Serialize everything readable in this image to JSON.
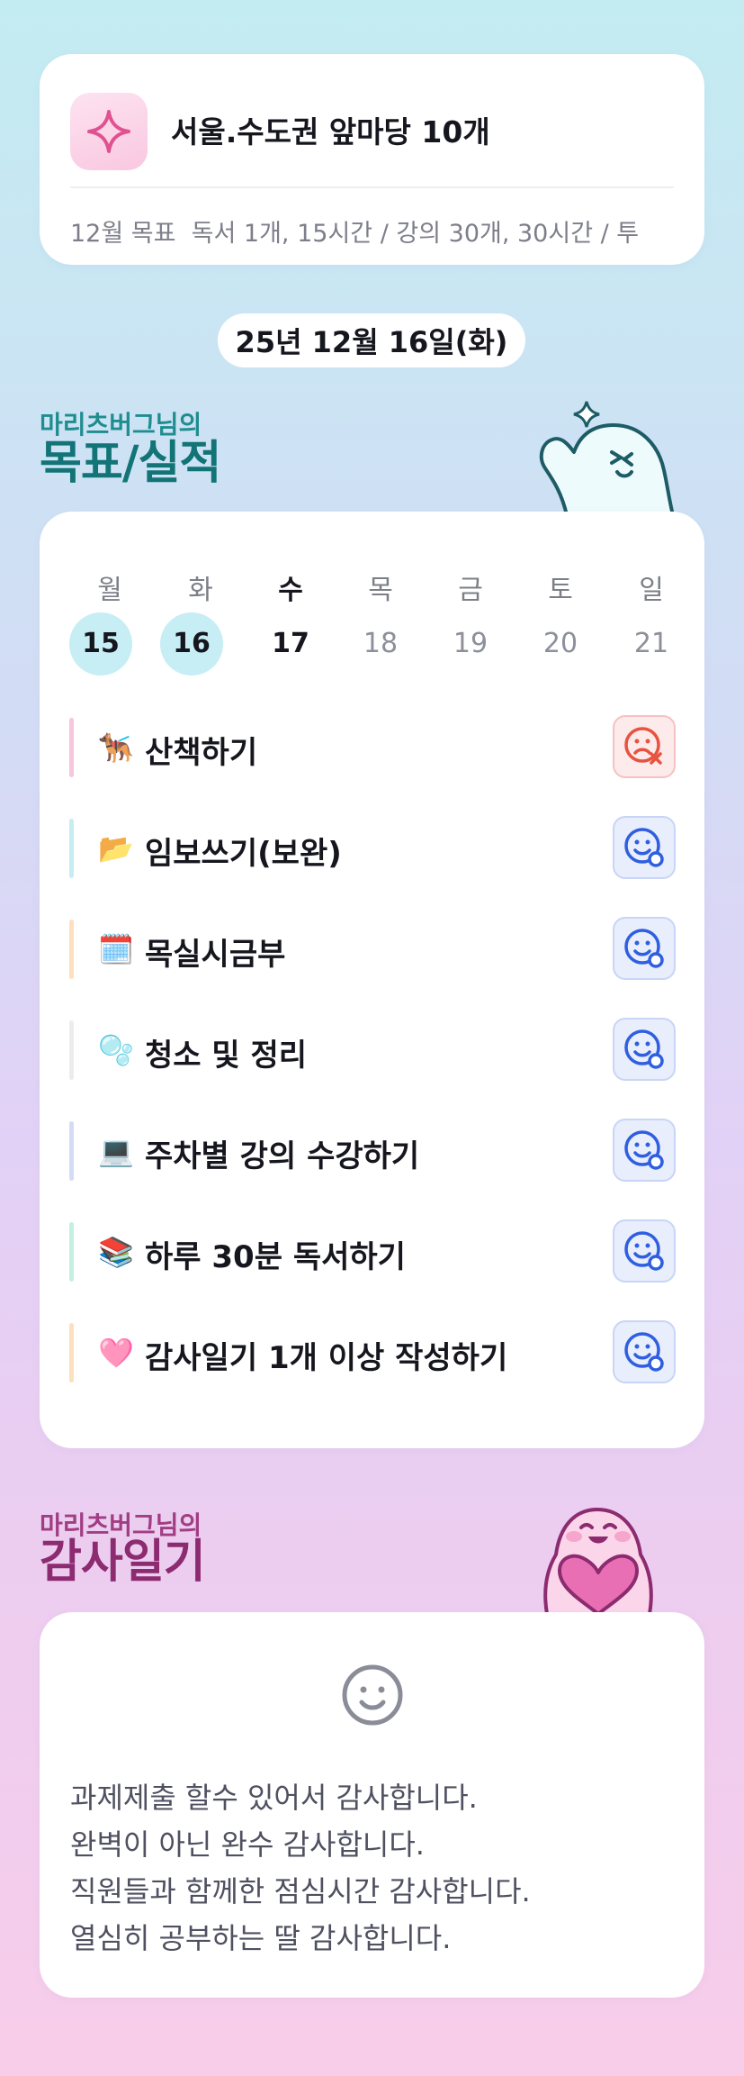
{
  "goal": {
    "icon": "sparkle-icon",
    "title": "서울.수도권 앞마당 10개",
    "monthly_label": "12월 목표",
    "monthly_text": "독서 1개, 15시간 / 강의 30개, 30시간 / 투"
  },
  "date": "25년 12월 16일(화)",
  "goals_section": {
    "subtitle": "마리츠버그님의",
    "title": "목표/실적"
  },
  "calendar": {
    "weekdays": [
      "월",
      "화",
      "수",
      "목",
      "금",
      "토",
      "일"
    ],
    "days": [
      "15",
      "16",
      "17",
      "18",
      "19",
      "20",
      "21"
    ]
  },
  "tasks": [
    {
      "emoji": "🐕‍🦺",
      "label": "산책하기",
      "bar_color": "#f7c6dc",
      "status": "failed"
    },
    {
      "emoji": "📂",
      "label": "임보쓰기(보완)",
      "bar_color": "#c5eef3",
      "status": "pending"
    },
    {
      "emoji": "🗓️",
      "label": "목실시금부",
      "bar_color": "#fde0bd",
      "status": "pending"
    },
    {
      "emoji": "🫧",
      "label": "청소 및 정리",
      "bar_color": "#ececef",
      "status": "pending"
    },
    {
      "emoji": "💻",
      "label": "주차별 강의 수강하기",
      "bar_color": "#d3dcf5",
      "status": "pending"
    },
    {
      "emoji": "📚",
      "label": "하루 30분 독서하기",
      "bar_color": "#c5f0df",
      "status": "pending"
    },
    {
      "emoji": "🩷",
      "label": "감사일기 1개 이상 작성하기",
      "bar_color": "#fde0bd",
      "status": "pending"
    }
  ],
  "gratitude_section": {
    "subtitle": "마리츠버그님의",
    "title": "감사일기"
  },
  "gratitude": {
    "icon": "smile-face-icon",
    "lines": [
      "과제제출 할수 있어서 감사합니다.",
      "완벽이 아닌 완수 감사합니다.",
      "직원들과 함께한 점심시간 감사합니다.",
      "열심히 공부하는 딸 감사합니다."
    ]
  },
  "colors": {
    "accent_teal": "#1f8d8f",
    "accent_purple": "#a13e83",
    "failed_red": "#e7533f",
    "pending_blue": "#2f5fe0"
  }
}
